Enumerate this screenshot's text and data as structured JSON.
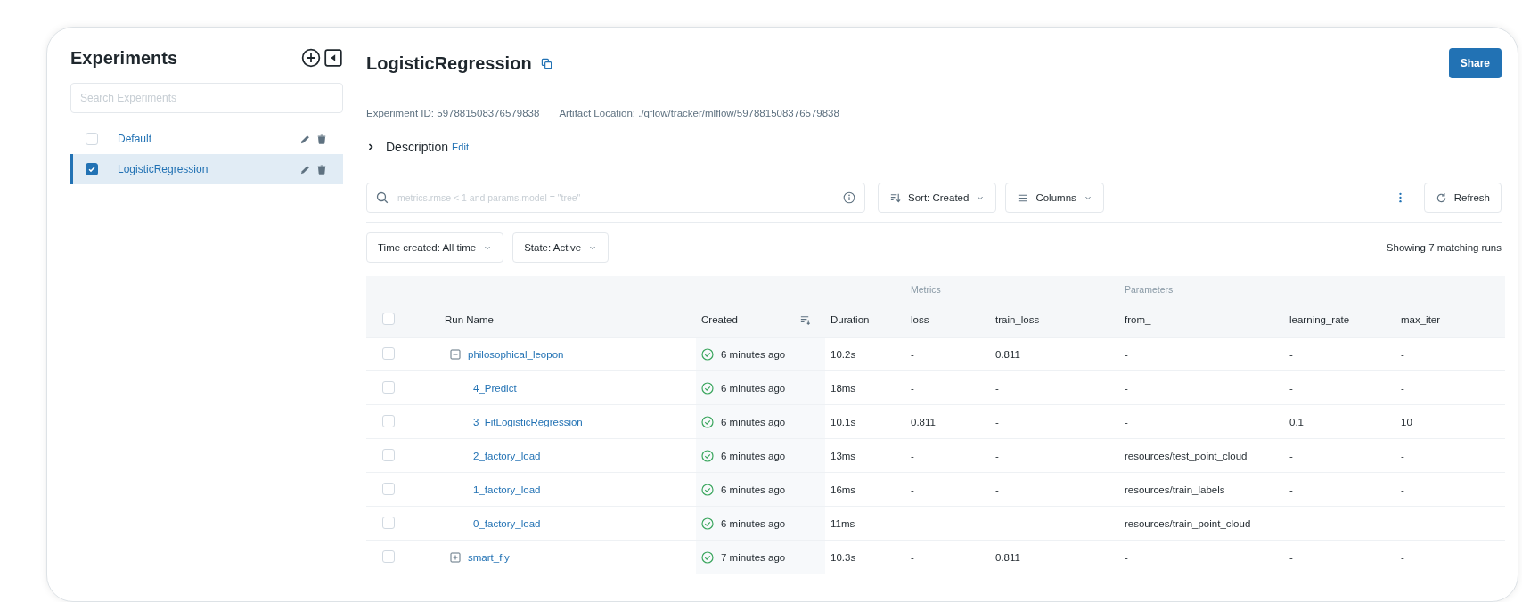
{
  "sidebar": {
    "title": "Experiments",
    "search_placeholder": "Search Experiments",
    "items": [
      {
        "name": "Default",
        "checked": false,
        "selected": false
      },
      {
        "name": "LogisticRegression",
        "checked": true,
        "selected": true
      }
    ]
  },
  "header": {
    "title": "LogisticRegression",
    "share_button": "Share",
    "experiment_id": "Experiment ID: 597881508376579838",
    "artifact_location": "Artifact Location: ./qflow/tracker/mlflow/597881508376579838",
    "description_label": "Description",
    "edit_link": "Edit",
    "description_expanded": false
  },
  "toolbar": {
    "search_placeholder": "metrics.rmse < 1 and params.model = \"tree\"",
    "sort_button": "Sort: Created",
    "columns_button": "Columns",
    "refresh_button": "Refresh",
    "filters": [
      "Time created: All time",
      "State: Active"
    ],
    "run_count": "Showing 7 matching runs"
  },
  "table": {
    "select_all_checked": false,
    "column_groups": [
      {
        "columns": [
          "Run Name",
          "Created",
          "Duration"
        ]
      },
      {
        "label": "Metrics",
        "columns": [
          "loss",
          "train_loss"
        ]
      },
      {
        "label": "Parameters",
        "columns": [
          "from_",
          "learning_rate",
          "max_iter"
        ]
      }
    ],
    "rows": [
      {
        "kind": "parent",
        "expanded": true,
        "checked": false,
        "name": "philosophical_leopon",
        "created": "6 minutes ago",
        "duration": "10.2s",
        "cells": [
          "-",
          "0.811",
          "-",
          "-",
          "-"
        ]
      },
      {
        "kind": "child",
        "checked": false,
        "name": "4_Predict",
        "created": "6 minutes ago",
        "duration": "18ms",
        "cells": [
          "-",
          "-",
          "-",
          "-",
          "-"
        ]
      },
      {
        "kind": "child",
        "checked": false,
        "name": "3_FitLogisticRegression",
        "created": "6 minutes ago",
        "duration": "10.1s",
        "cells": [
          "0.811",
          "-",
          "-",
          "0.1",
          "10"
        ]
      },
      {
        "kind": "child",
        "checked": false,
        "name": "2_factory_load",
        "created": "6 minutes ago",
        "duration": "13ms",
        "cells": [
          "-",
          "-",
          "resources/test_point_cloud",
          "-",
          "-"
        ]
      },
      {
        "kind": "child",
        "checked": false,
        "name": "1_factory_load",
        "created": "6 minutes ago",
        "duration": "16ms",
        "cells": [
          "-",
          "-",
          "resources/train_labels",
          "-",
          "-"
        ]
      },
      {
        "kind": "child",
        "checked": false,
        "name": "0_factory_load",
        "created": "6 minutes ago",
        "duration": "11ms",
        "cells": [
          "-",
          "-",
          "resources/train_point_cloud",
          "-",
          "-"
        ]
      },
      {
        "kind": "parent",
        "expanded": false,
        "checked": false,
        "name": "smart_fly",
        "created": "7 minutes ago",
        "duration": "10.3s",
        "cells": [
          "-",
          "0.811",
          "-",
          "-",
          "-"
        ]
      }
    ]
  }
}
